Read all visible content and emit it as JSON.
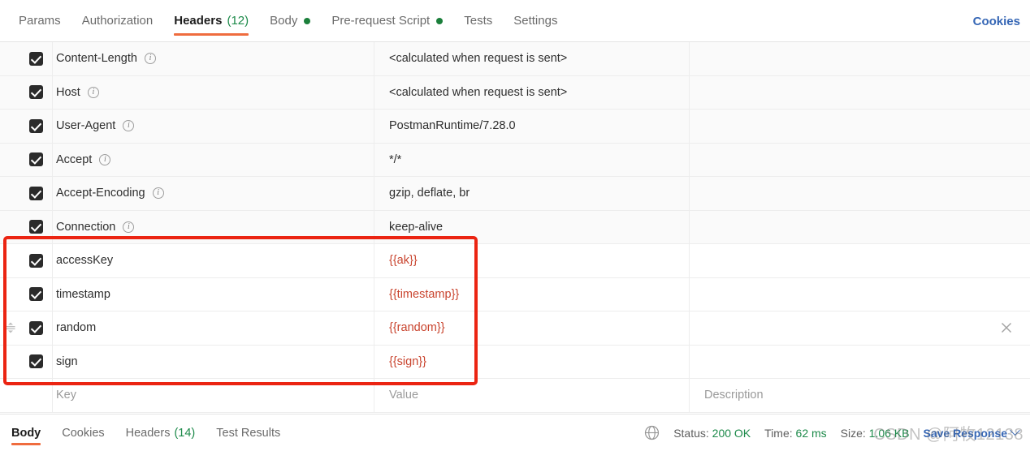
{
  "request_tabs": {
    "items": [
      {
        "label": "Params",
        "count": null,
        "dot": false,
        "active": false
      },
      {
        "label": "Authorization",
        "count": null,
        "dot": false,
        "active": false
      },
      {
        "label": "Headers",
        "count": "(12)",
        "dot": false,
        "active": true
      },
      {
        "label": "Body",
        "count": null,
        "dot": true,
        "active": false
      },
      {
        "label": "Pre-request Script",
        "count": null,
        "dot": true,
        "active": false
      },
      {
        "label": "Tests",
        "count": null,
        "dot": false,
        "active": false
      },
      {
        "label": "Settings",
        "count": null,
        "dot": false,
        "active": false
      }
    ],
    "cookies_link": "Cookies"
  },
  "headers_table": {
    "columns": {
      "key": "Key",
      "value": "Value",
      "description": "Description"
    },
    "rows": [
      {
        "checked": true,
        "key": "Content-Length",
        "info": true,
        "value": "<calculated when request is sent>",
        "description": "",
        "highlighted": false,
        "handle": false,
        "close": false
      },
      {
        "checked": true,
        "key": "Host",
        "info": true,
        "value": "<calculated when request is sent>",
        "description": "",
        "highlighted": false,
        "handle": false,
        "close": false
      },
      {
        "checked": true,
        "key": "User-Agent",
        "info": true,
        "value": "PostmanRuntime/7.28.0",
        "description": "",
        "highlighted": false,
        "handle": false,
        "close": false
      },
      {
        "checked": true,
        "key": "Accept",
        "info": true,
        "value": "*/*",
        "description": "",
        "highlighted": false,
        "handle": false,
        "close": false
      },
      {
        "checked": true,
        "key": "Accept-Encoding",
        "info": true,
        "value": "gzip, deflate, br",
        "description": "",
        "highlighted": false,
        "handle": false,
        "close": false
      },
      {
        "checked": true,
        "key": "Connection",
        "info": true,
        "value": "keep-alive",
        "description": "",
        "highlighted": false,
        "handle": false,
        "close": false
      },
      {
        "checked": true,
        "key": "accessKey",
        "info": false,
        "value": "{{ak}}",
        "description": "",
        "highlighted": true,
        "handle": false,
        "close": false
      },
      {
        "checked": true,
        "key": "timestamp",
        "info": false,
        "value": "{{timestamp}}",
        "description": "",
        "highlighted": true,
        "handle": false,
        "close": false
      },
      {
        "checked": true,
        "key": "random",
        "info": false,
        "value": "{{random}}",
        "description": "",
        "highlighted": true,
        "handle": true,
        "close": true
      },
      {
        "checked": true,
        "key": "sign",
        "info": false,
        "value": "{{sign}}",
        "description": "",
        "highlighted": true,
        "handle": false,
        "close": false
      }
    ],
    "placeholder_row": {
      "key": "Key",
      "value": "Value",
      "description": "Description"
    }
  },
  "response_bar": {
    "tabs": [
      {
        "label": "Body",
        "count": null,
        "active": true
      },
      {
        "label": "Cookies",
        "count": null,
        "active": false
      },
      {
        "label": "Headers",
        "count": "(14)",
        "active": false
      },
      {
        "label": "Test Results",
        "count": null,
        "active": false
      }
    ],
    "status_label": "Status:",
    "status_value": "200 OK",
    "time_label": "Time:",
    "time_value": "62 ms",
    "size_label": "Size:",
    "size_value": "1.06 KB",
    "save_response": "Save Response"
  },
  "watermark": {
    "text": "CSDN @阿牧12138"
  },
  "colors": {
    "accent_orange": "#ef6c3e",
    "link_blue": "#3566b5",
    "success_green": "#1d8a4a",
    "variable_red": "#c9442e",
    "annotation_red": "#eb2412",
    "checkbox_dark": "#2b2b2b"
  }
}
